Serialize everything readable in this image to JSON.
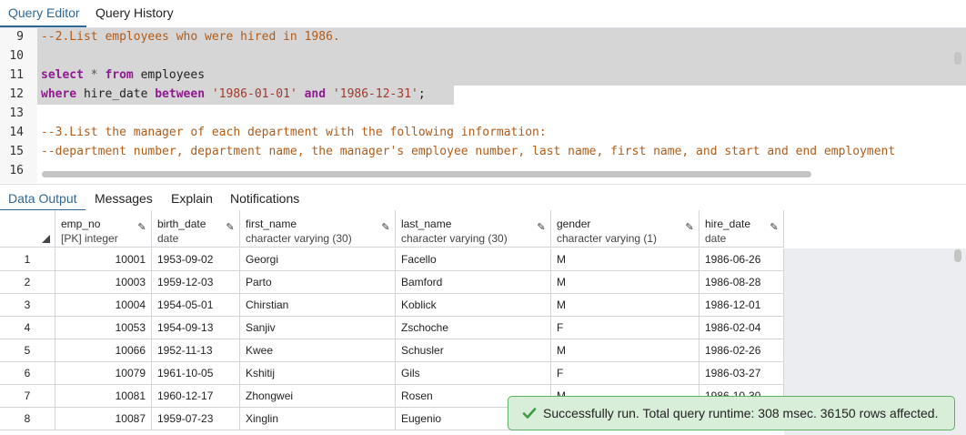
{
  "top_tabs": [
    "Query Editor",
    "Query History"
  ],
  "editor": {
    "lines": [
      {
        "n": "9",
        "tokens": [
          {
            "t": "--2.List employees who were hired in 1986.",
            "c": "cmt"
          }
        ]
      },
      {
        "n": "10",
        "tokens": []
      },
      {
        "n": "11",
        "tokens": [
          {
            "t": "select",
            "c": "kw"
          },
          {
            "t": " * ",
            "c": "op"
          },
          {
            "t": "from",
            "c": "kw"
          },
          {
            "t": " employees",
            "c": ""
          }
        ]
      },
      {
        "n": "12",
        "tokens": [
          {
            "t": "where",
            "c": "kw"
          },
          {
            "t": " hire_date ",
            "c": ""
          },
          {
            "t": "between",
            "c": "kw"
          },
          {
            "t": " ",
            "c": ""
          },
          {
            "t": "'1986-01-01'",
            "c": "str"
          },
          {
            "t": " ",
            "c": ""
          },
          {
            "t": "and",
            "c": "kw"
          },
          {
            "t": " ",
            "c": ""
          },
          {
            "t": "'1986-12-31'",
            "c": "str"
          },
          {
            "t": ";",
            "c": ""
          }
        ]
      },
      {
        "n": "13",
        "tokens": []
      },
      {
        "n": "14",
        "tokens": [
          {
            "t": "--3.List the manager of each department with the following information:",
            "c": "cmt"
          }
        ]
      },
      {
        "n": "15",
        "tokens": [
          {
            "t": "--department number, department name, the manager's employee number, last name, first name, and start and end employment",
            "c": "cmt"
          }
        ]
      },
      {
        "n": "16",
        "tokens": []
      }
    ]
  },
  "bottom_tabs": [
    "Data Output",
    "Messages",
    "Explain",
    "Notifications"
  ],
  "grid": {
    "columns": [
      {
        "name": "emp_no",
        "type": "[PK] integer"
      },
      {
        "name": "birth_date",
        "type": "date"
      },
      {
        "name": "first_name",
        "type": "character varying (30)"
      },
      {
        "name": "last_name",
        "type": "character varying (30)"
      },
      {
        "name": "gender",
        "type": "character varying (1)"
      },
      {
        "name": "hire_date",
        "type": "date"
      }
    ],
    "rows": [
      {
        "n": "1",
        "cells": [
          "10001",
          "1953-09-02",
          "Georgi",
          "Facello",
          "M",
          "1986-06-26"
        ]
      },
      {
        "n": "2",
        "cells": [
          "10003",
          "1959-12-03",
          "Parto",
          "Bamford",
          "M",
          "1986-08-28"
        ]
      },
      {
        "n": "3",
        "cells": [
          "10004",
          "1954-05-01",
          "Chirstian",
          "Koblick",
          "M",
          "1986-12-01"
        ]
      },
      {
        "n": "4",
        "cells": [
          "10053",
          "1954-09-13",
          "Sanjiv",
          "Zschoche",
          "F",
          "1986-02-04"
        ]
      },
      {
        "n": "5",
        "cells": [
          "10066",
          "1952-11-13",
          "Kwee",
          "Schusler",
          "M",
          "1986-02-26"
        ]
      },
      {
        "n": "6",
        "cells": [
          "10079",
          "1961-10-05",
          "Kshitij",
          "Gils",
          "F",
          "1986-03-27"
        ]
      },
      {
        "n": "7",
        "cells": [
          "10081",
          "1960-12-17",
          "Zhongwei",
          "Rosen",
          "M",
          "1986-10-30"
        ]
      },
      {
        "n": "8",
        "cells": [
          "10087",
          "1959-07-23",
          "Xinglin",
          "Eugenio",
          "",
          ""
        ]
      }
    ]
  },
  "toast": {
    "message": "Successfully run. Total query runtime: 308 msec. 36150 rows affected."
  },
  "colors": {
    "accent": "#326690",
    "success": "#5fae63",
    "comment": "#b05c1b",
    "keyword": "#8e1b8e",
    "string": "#a1392d"
  }
}
